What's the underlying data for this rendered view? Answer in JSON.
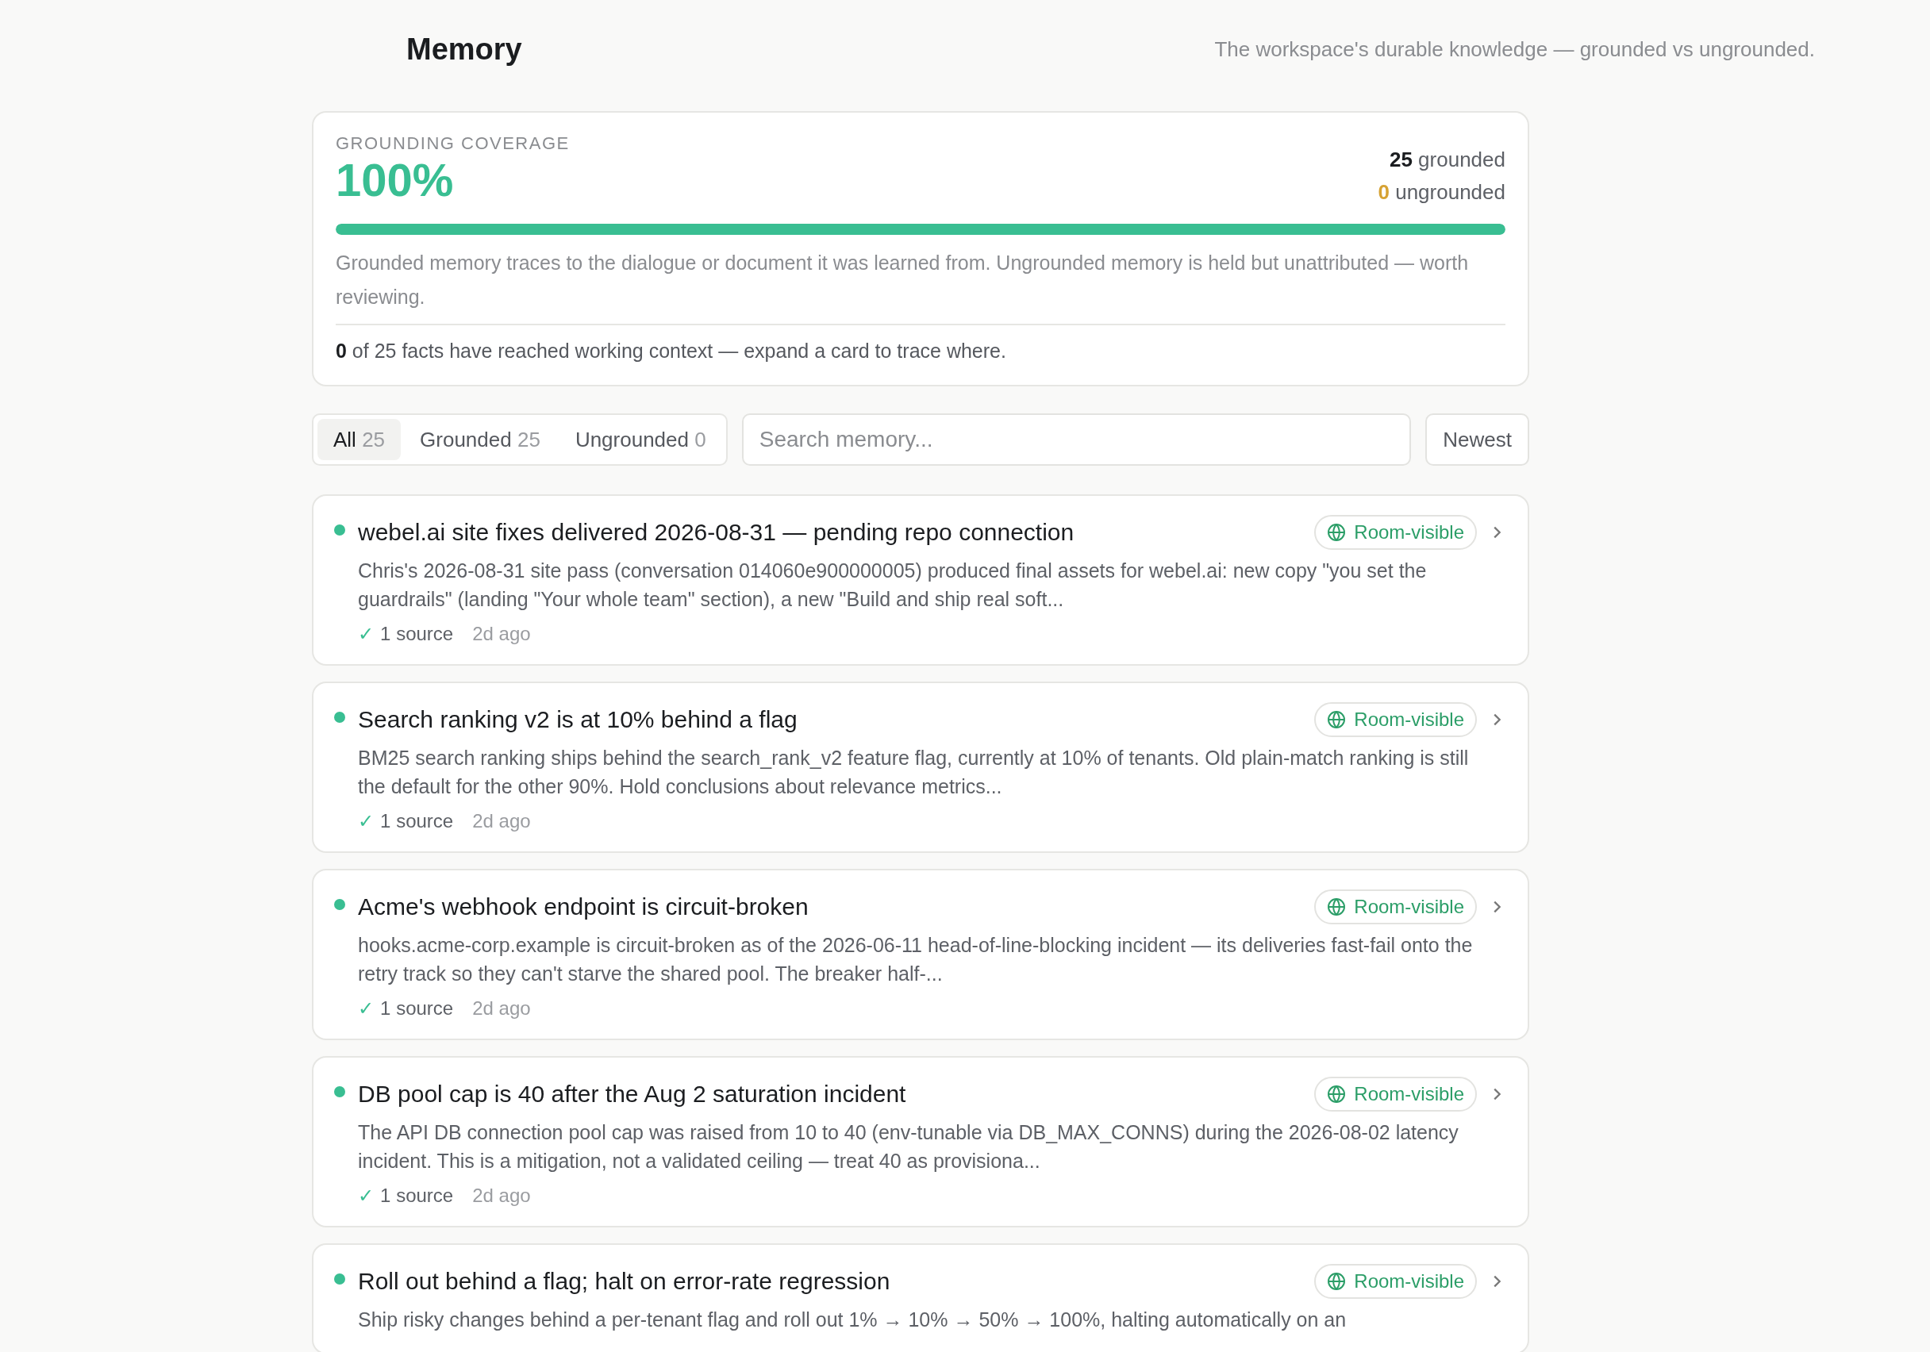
{
  "header": {
    "title": "Memory",
    "subtitle": "The workspace's durable knowledge — grounded vs ungrounded."
  },
  "coverage": {
    "label": "GROUNDING COVERAGE",
    "value": "100%",
    "level": 1,
    "grounded": {
      "count": "25",
      "label": "grounded"
    },
    "ungrounded": {
      "count": "0",
      "label": "ungrounded"
    },
    "note": "Grounded memory traces to the dialogue or document it was learned from. Ungrounded memory is held but unattributed — worth reviewing.",
    "context": "**0** of 25 facts have reached working context — expand a card to trace where."
  },
  "filters": {
    "tabs": [
      {
        "label": "All",
        "count": "25",
        "selected": true
      },
      {
        "label": "Grounded",
        "count": "25",
        "selected": false
      },
      {
        "label": "Ungrounded",
        "count": "0",
        "selected": false
      }
    ],
    "search": {
      "placeholder": "Search memory..."
    },
    "sort": "Newest"
  },
  "memories": [
    {
      "title": "webel.ai site fixes delivered 2026-08-31 — pending repo connection",
      "grounded": true,
      "badge": "Room-visible",
      "description": "Chris's 2026-08-31 site pass (conversation 014060e900000005) produced final assets for webel.ai: new copy \"you set the guardrails\" (landing \"Your whole team\" section), a new \"Build and ship real soft...",
      "check": "✓",
      "sources": "1 source",
      "age": "2d ago"
    },
    {
      "title": "Search ranking v2 is at 10% behind a flag",
      "grounded": true,
      "badge": "Room-visible",
      "description": "BM25 search ranking ships behind the search_rank_v2 feature flag, currently at 10% of tenants. Old plain-match ranking is still the default for the other 90%. Hold conclusions about relevance metrics...",
      "check": "✓",
      "sources": "1 source",
      "age": "2d ago"
    },
    {
      "title": "Acme's webhook endpoint is circuit-broken",
      "grounded": true,
      "badge": "Room-visible",
      "description": "hooks.acme-corp.example is circuit-broken as of the 2026-06-11 head-of-line-blocking incident — its deliveries fast-fail onto the retry track so they can't starve the shared pool. The breaker half-...",
      "check": "✓",
      "sources": "1 source",
      "age": "2d ago"
    },
    {
      "title": "DB pool cap is 40 after the Aug 2 saturation incident",
      "grounded": true,
      "badge": "Room-visible",
      "description": "The API DB connection pool cap was raised from 10 to 40 (env-tunable via DB_MAX_CONNS) during the 2026-08-02 latency incident. This is a mitigation, not a validated ceiling — treat 40 as provisiona...",
      "check": "✓",
      "sources": "1 source",
      "age": "2d ago"
    },
    {
      "title": "Roll out behind a flag; halt on error-rate regression",
      "grounded": true,
      "badge": "Room-visible",
      "description": "Ship risky changes behind a per-tenant flag and roll out 1% → 10% → 50% → 100%, halting automatically on an"
    }
  ]
}
